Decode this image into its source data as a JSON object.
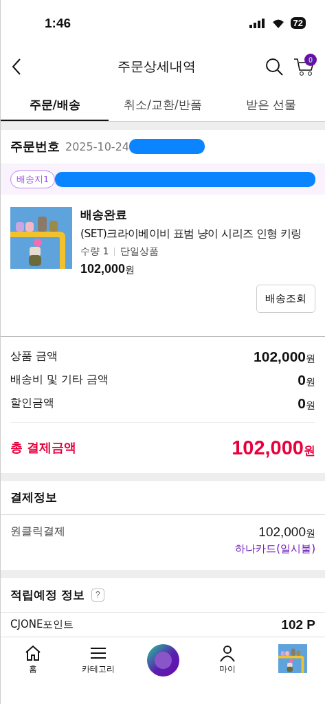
{
  "status_bar": {
    "time": "1:46",
    "battery": "72"
  },
  "header": {
    "title": "주문상세내역",
    "cart_count": "0"
  },
  "tabs": [
    {
      "label": "주문/배송",
      "selected": true
    },
    {
      "label": "취소/교환/반품",
      "selected": false
    },
    {
      "label": "받은 선물",
      "selected": false
    }
  ],
  "order": {
    "label": "주문번호",
    "number": "2025-10-24"
  },
  "address": {
    "tag": "배송지1"
  },
  "product": {
    "status": "배송완료",
    "name": "(SET)크라이베이비 표범 냥이 시리즈 인형 키링",
    "quantity": "수량 1",
    "option": "단일상품",
    "price": "102,000",
    "currency": "원",
    "button": "배송조회"
  },
  "summary": {
    "rows": [
      {
        "label": "상품 금액",
        "amount": "102,000",
        "unit": "원"
      },
      {
        "label": "배송비 및 기타 금액",
        "amount": "0",
        "unit": "원"
      },
      {
        "label": "할인금액",
        "amount": "0",
        "unit": "원"
      }
    ],
    "total": {
      "label": "총 결제금액",
      "amount": "102,000",
      "unit": "원"
    }
  },
  "payment": {
    "title": "결제정보",
    "method": "원클릭결제",
    "amount": "102,000",
    "unit": "원",
    "card": "하나카드(일시불)"
  },
  "points": {
    "title": "적립예정 정보",
    "help": "?",
    "rows": [
      {
        "label": "CJONE포인트",
        "value": "102 P"
      }
    ]
  },
  "bottom_nav": [
    {
      "kind": "home",
      "label": "홈"
    },
    {
      "kind": "menu",
      "label": "카테고리"
    },
    {
      "kind": "orb"
    },
    {
      "kind": "user",
      "label": "마이"
    },
    {
      "kind": "picture"
    }
  ]
}
